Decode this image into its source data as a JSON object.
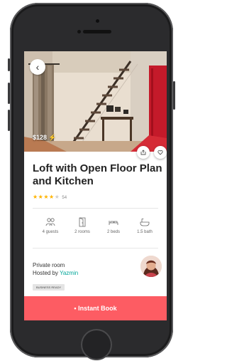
{
  "listing": {
    "price": "$128",
    "title": "Loft with Open Floor Plan and Kitchen",
    "rating": {
      "stars": 4,
      "max_stars": 5,
      "review_count": "54"
    },
    "room_type": "Private room",
    "host_prefix": "Hosted by ",
    "host_name": "Yazmin",
    "badge": "BUSINESS READY"
  },
  "amenities": [
    {
      "label": "4 guests",
      "icon": "guests-icon"
    },
    {
      "label": "2 rooms",
      "icon": "rooms-icon"
    },
    {
      "label": "2 beds",
      "icon": "beds-icon"
    },
    {
      "label": "1.5 bath",
      "icon": "bath-icon"
    }
  ],
  "cta": {
    "label": "• Instant Book"
  },
  "colors": {
    "accent": "#fd5c63",
    "star": "#ffb400",
    "host_link": "#00a699"
  }
}
